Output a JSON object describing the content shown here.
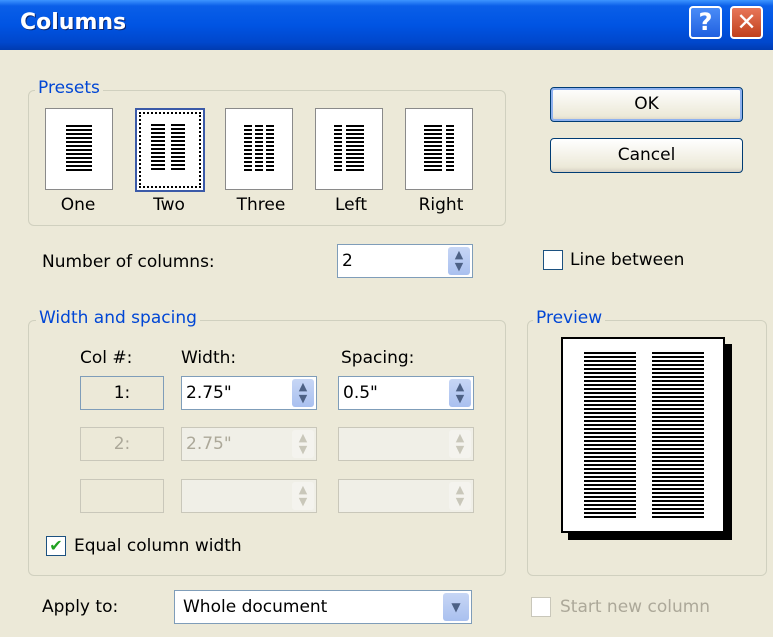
{
  "window": {
    "title": "Columns",
    "help_glyph": "?",
    "close_glyph": "✕"
  },
  "presets": {
    "group_label": "Presets",
    "items": [
      {
        "label": "One",
        "accel": "O"
      },
      {
        "label": "Two",
        "accel": "w",
        "selected": true
      },
      {
        "label": "Three",
        "accel": "T"
      },
      {
        "label": "Left",
        "accel": "L"
      },
      {
        "label": "Right",
        "accel": "R"
      }
    ]
  },
  "buttons": {
    "ok": "OK",
    "cancel": "Cancel"
  },
  "number_of_columns": {
    "label": "Number of columns:",
    "value": "2"
  },
  "line_between": {
    "label": "Line between",
    "checked": false
  },
  "width_spacing": {
    "group_label": "Width and spacing",
    "col_header": "Col #:",
    "width_header": "Width:",
    "spacing_header": "Spacing:",
    "rows": [
      {
        "col": "1:",
        "width": "2.75\"",
        "spacing": "0.5\"",
        "enabled": true
      },
      {
        "col": "2:",
        "width": "2.75\"",
        "spacing": "",
        "enabled": false
      },
      {
        "col": "",
        "width": "",
        "spacing": "",
        "enabled": false
      }
    ],
    "equal_width": {
      "label": "Equal column width",
      "checked": true
    }
  },
  "preview": {
    "group_label": "Preview",
    "columns": 2
  },
  "apply_to": {
    "label": "Apply to:",
    "value": "Whole document"
  },
  "start_new_column": {
    "label": "Start new column",
    "checked": false,
    "enabled": false
  }
}
